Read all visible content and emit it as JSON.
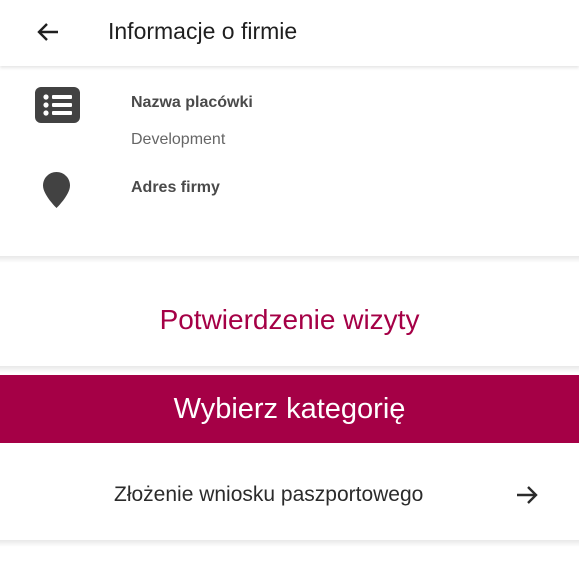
{
  "header": {
    "title": "Informacje o firmie",
    "back_icon": "arrow-left-icon"
  },
  "company_info": {
    "name_label": "Nazwa placówki",
    "name_value": "Development",
    "address_label": "Adres firmy",
    "name_icon": "list-icon",
    "address_icon": "location-pin-icon"
  },
  "visit": {
    "title": "Potwierdzenie wizyty"
  },
  "category": {
    "title": "Wybierz kategorię",
    "items": [
      {
        "label": "Złożenie wniosku paszportowego",
        "icon": "arrow-right-icon"
      }
    ]
  },
  "colors": {
    "accent": "#a50046",
    "icon_dark": "#424242"
  }
}
